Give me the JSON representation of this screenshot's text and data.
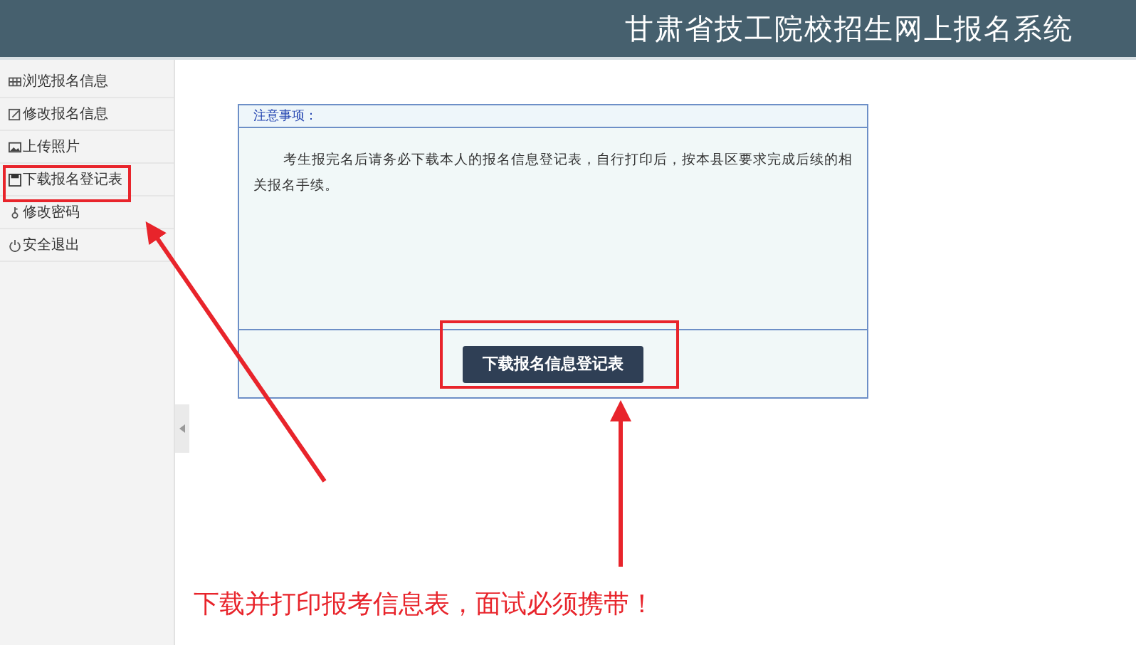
{
  "header": {
    "title": "甘肃省技工院校招生网上报名系统"
  },
  "sidebar": {
    "items": [
      {
        "label": "浏览报名信息"
      },
      {
        "label": "修改报名信息"
      },
      {
        "label": "上传照片"
      },
      {
        "label": "下载报名登记表"
      },
      {
        "label": "修改密码"
      },
      {
        "label": "安全退出"
      }
    ]
  },
  "notice": {
    "heading": "注意事项：",
    "text": "考生报完名后请务必下载本人的报名信息登记表，自行打印后，按本县区要求完成后续的相关报名手续。"
  },
  "download_button": "下载报名信息登记表",
  "annotation": {
    "caption": "下载并打印报考信息表，面试必须携带！"
  }
}
